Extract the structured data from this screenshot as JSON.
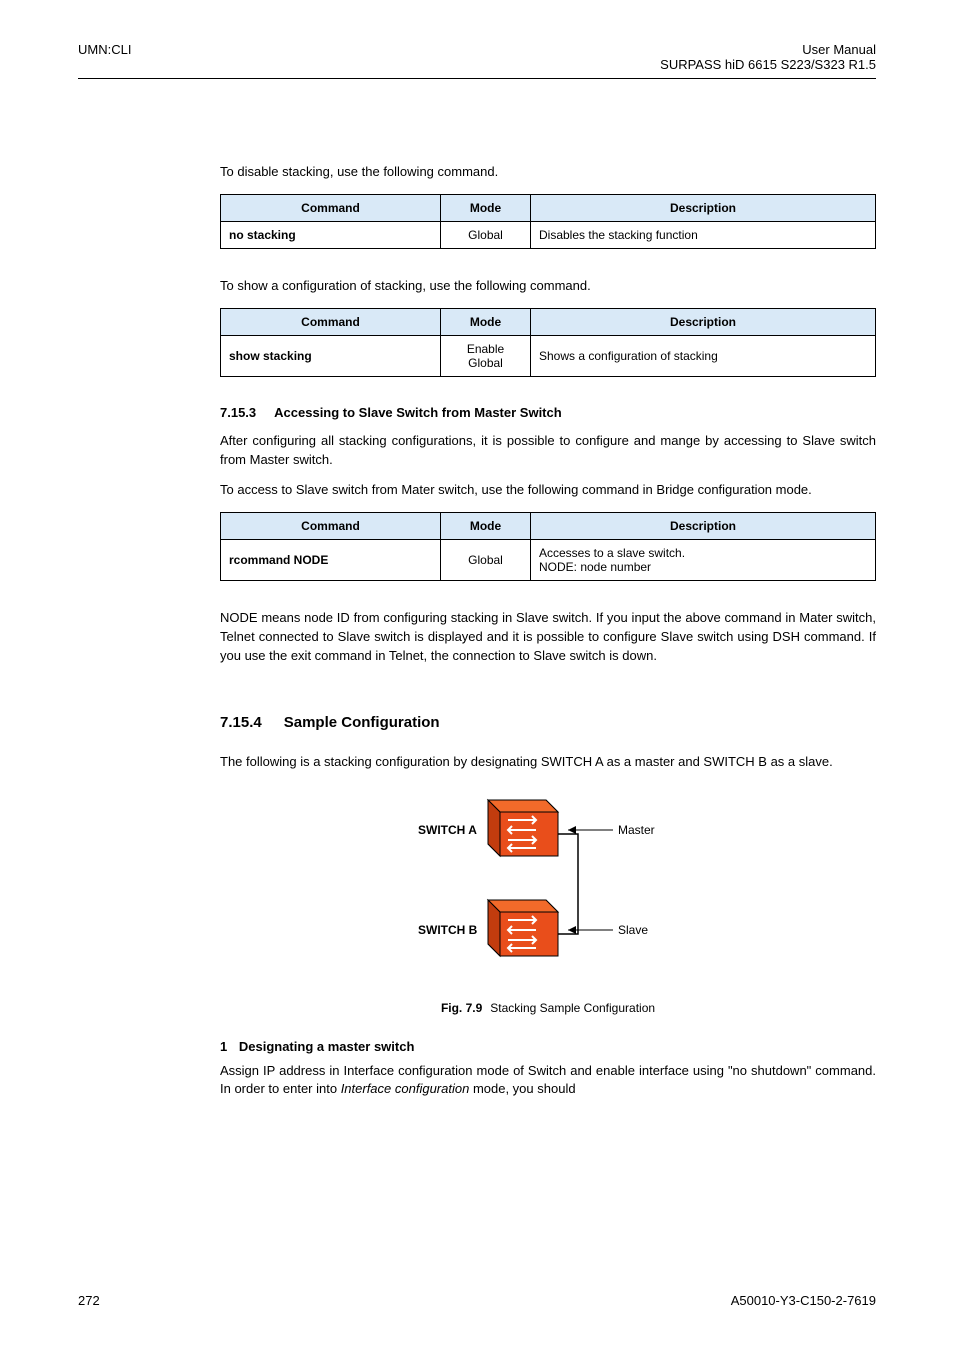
{
  "header": {
    "left": "UMN:CLI",
    "right_line1": "User Manual",
    "right_line2": "SURPASS hiD 6615 S223/S323 R1.5"
  },
  "para_disable": "To disable stacking, use the following command.",
  "table_headers": {
    "c1": "Command",
    "c2": "Mode",
    "c3": "Description"
  },
  "table_disable": {
    "c1": "no stacking",
    "c2": "Global",
    "c3": "Disables the stacking function"
  },
  "para_show": "To show a configuration of stacking, use the following command.",
  "table_show": {
    "c1": "show stacking",
    "c2a": "Enable",
    "c2b": "Global",
    "c3": "Shows a configuration of stacking"
  },
  "sec_access": {
    "num": "7.15.3",
    "title": "Accessing to Slave Switch from Master Switch",
    "p1": "After configuring all stacking configurations, it is possible to configure and mange by accessing to Slave switch from Master switch.",
    "p2": "To access to Slave switch from Mater switch, use the following command in Bridge configuration mode."
  },
  "table_rcommand": {
    "c1": "rcommand NODE",
    "c2": "Global",
    "c3a": "Accesses to a slave switch.",
    "c3b": "NODE: node number"
  },
  "para_node": "NODE means node ID from configuring stacking in Slave switch. If you input the above command in Mater switch, Telnet connected to Slave switch is displayed and it is possible to configure Slave switch using DSH command. If you use the exit command in Telnet, the connection to Slave switch is down.",
  "sec_sample": {
    "num": "7.15.4",
    "title": "Sample Configuration",
    "p1": "The following is a stacking configuration by designating SWITCH A as a master and SWITCH B as a slave."
  },
  "fig": {
    "switchA": "SWITCH A",
    "switchB": "SWITCH B",
    "master": "Master",
    "slave": "Slave",
    "caption_bold": "Fig. 7.9",
    "caption_text": "Stacking Sample Configuration"
  },
  "step1": {
    "num": "1",
    "title": "Designating a master switch",
    "text_before": "Assign IP address in Interface configuration mode of Switch and enable interface using \"no shutdown\" command. In order to enter into ",
    "italic": "Interface configuration",
    "text_after": " mode, you should"
  },
  "footer": {
    "left": "272",
    "right": "A50010-Y3-C150-2-7619"
  }
}
